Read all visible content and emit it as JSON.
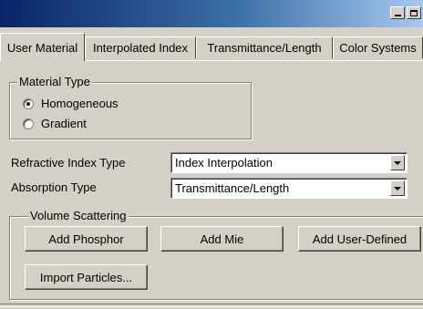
{
  "window": {
    "title": ""
  },
  "tabs": [
    {
      "label": "User Material",
      "active": true
    },
    {
      "label": "Interpolated Index",
      "active": false
    },
    {
      "label": "Transmittance/Length",
      "active": false
    },
    {
      "label": "Color Systems",
      "active": false
    }
  ],
  "material_type": {
    "title": "Material Type",
    "options": [
      {
        "label": "Homogeneous",
        "selected": true
      },
      {
        "label": "Gradient",
        "selected": false
      }
    ]
  },
  "refractive_index": {
    "label": "Refractive Index Type",
    "value": "Index Interpolation"
  },
  "absorption": {
    "label": "Absorption Type",
    "value": "Transmittance/Length"
  },
  "volume_scattering": {
    "title": "Volume Scattering",
    "buttons": {
      "add_phosphor": "Add Phosphor",
      "add_mie": "Add Mie",
      "add_user_defined": "Add User-Defined",
      "import_particles": "Import Particles..."
    }
  },
  "colors": {
    "title_start": "#0a246a",
    "title_end": "#a6caf0",
    "face": "#d4d0c8"
  }
}
